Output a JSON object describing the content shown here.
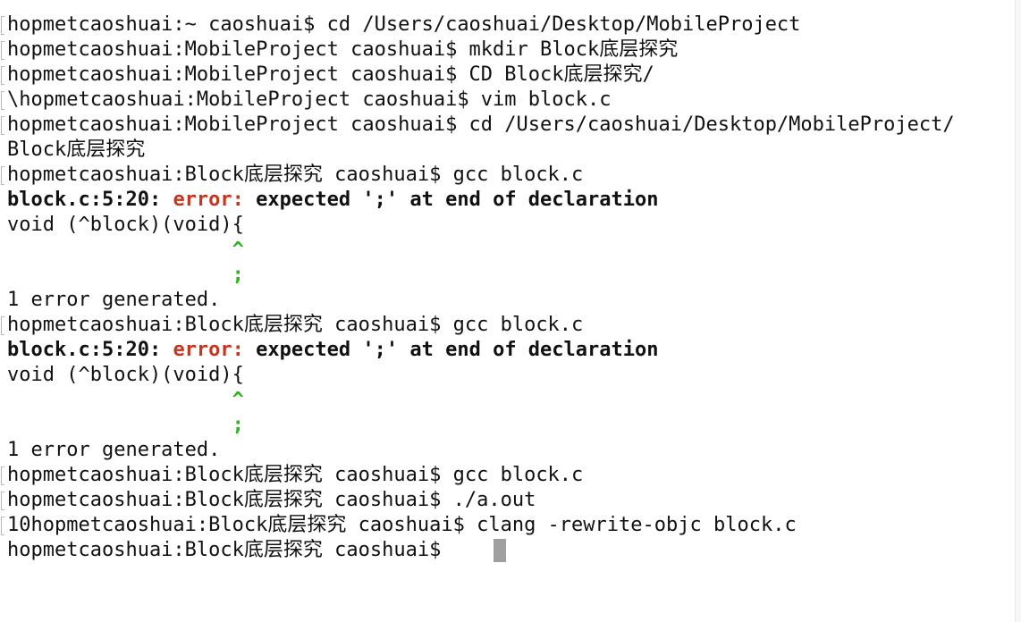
{
  "terminal": {
    "lines": [
      "hopmetcaoshuai:~ caoshuai$ cd /Users/caoshuai/Desktop/MobileProject",
      "hopmetcaoshuai:MobileProject caoshuai$ mkdir Block底层探究",
      "hopmetcaoshuai:MobileProject caoshuai$ CD Block底层探究/",
      "\\hopmetcaoshuai:MobileProject caoshuai$ vim block.c",
      "hopmetcaoshuai:MobileProject caoshuai$ cd /Users/caoshuai/Desktop/MobileProject/",
      "Block底层探究",
      "hopmetcaoshuai:Block底层探究 caoshuai$ gcc block.c",
      "",
      "void (^block)(void){",
      "                   ^",
      "",
      "                   ;",
      "1 error generated.",
      "hopmetcaoshuai:Block底层探究 caoshuai$ gcc block.c",
      "",
      "void (^block)(void){",
      "                   ^",
      "",
      "                   ;",
      "1 error generated.",
      "hopmetcaoshuai:Block底层探究 caoshuai$ gcc block.c",
      "hopmetcaoshuai:Block底层探究 caoshuai$ ./a.out",
      "10hopmetcaoshuai:Block底层探究 caoshuai$ clang -rewrite-objc block.c",
      "hopmetcaoshuai:Block底层探究 caoshuai$ "
    ],
    "errors": [
      {
        "location": "block.c:5:20:",
        "label": "error:",
        "message": "expected ';' at end of declaration"
      },
      {
        "location": "block.c:5:20:",
        "label": "error:",
        "message": "expected ';' at end of declaration"
      }
    ],
    "colors": {
      "background": "#ffffff",
      "text": "#111111",
      "error": "#c33720",
      "caret": "#2fb41d",
      "cursor": "#a0a0a0"
    }
  }
}
